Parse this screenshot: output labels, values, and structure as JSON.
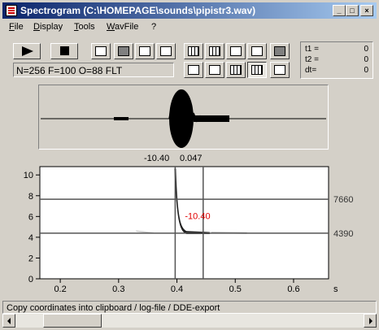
{
  "window": {
    "title": "Spectrogram (C:\\HOMEPAGE\\sounds\\pipistr3.wav)",
    "minimize_label": "_",
    "maximize_label": "□",
    "close_label": "×"
  },
  "menu": [
    {
      "label": "File",
      "key": "F",
      "rest": "ile"
    },
    {
      "label": "Display",
      "key": "D",
      "rest": "isplay"
    },
    {
      "label": "Tools",
      "key": "T",
      "rest": "ools"
    },
    {
      "label": "WavFile",
      "key": "W",
      "rest": "avFile"
    },
    {
      "label": "?",
      "key": "",
      "rest": "?"
    }
  ],
  "toolbar": {
    "play_icon": "play-icon",
    "stop_icon": "stop-icon",
    "params": "N=256 F=100 O=88 FLT"
  },
  "readout": {
    "t1_label": "t1 =",
    "t1_value": "0",
    "t2_label": "t2 =",
    "t2_value": "0",
    "dt_label": "dt=",
    "dt_value": "0"
  },
  "cursor_labels": {
    "time_left": "-10.40",
    "time_right": "0.047",
    "freq_marker": "-10.40"
  },
  "chart_data": {
    "type": "heatmap",
    "x_ticks": [
      "0.2",
      "0.3",
      "0.4",
      "0.5",
      "0.6"
    ],
    "x_tick_values": [
      0.2,
      0.3,
      0.4,
      0.5,
      0.6
    ],
    "x_unit": "s",
    "y_ticks": [
      "0",
      "2",
      "4",
      "6",
      "8",
      "10"
    ],
    "y_tick_values": [
      0,
      2,
      4,
      6,
      8,
      10
    ],
    "xlim": [
      0.165,
      0.66
    ],
    "ylim": [
      0,
      10.8
    ],
    "cursor_times": [
      0.397,
      0.445
    ],
    "cursor_freqs": [
      7.66,
      4.39
    ],
    "cursor_freq_labels": [
      "7660",
      "4390"
    ],
    "grid": false
  },
  "status_text": "Copy coordinates into clipboard / log-file / DDE-export"
}
